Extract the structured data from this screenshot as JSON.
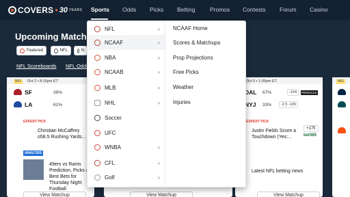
{
  "brand": {
    "name": "COVERS",
    "badge": "30",
    "years": "YEARS",
    "accent": "#f26b3a"
  },
  "nav": [
    "Sports",
    "Odds",
    "Picks",
    "Betting",
    "Promos",
    "Contests",
    "Forum",
    "Casino"
  ],
  "page": {
    "title": "Upcoming Matchups",
    "chips": [
      "Featured",
      "NFL",
      "N"
    ],
    "links": [
      "NFL Scoreboards",
      "NFL Odds"
    ]
  },
  "cards": {
    "left": {
      "tag": "NFL",
      "date": "Oct 2 • 8:15pm ET",
      "teams": [
        {
          "abbr": "SF",
          "pct": "39%"
        },
        {
          "abbr": "LA",
          "pct": "61%"
        }
      ],
      "expert_label": "EXPERT PICK",
      "expert_text": "Christian McCaffrey o58.5 Rushing Yards...",
      "analysis_label": "ANALYSIS",
      "analysis_text": "49ers vs Rams Prediction, Picks & Best Bets for Thursday Night Football",
      "button": "View Matchup"
    },
    "right": {
      "tag": "NFL",
      "date": "Oct 5 • 1:00pm ET",
      "teams": [
        {
          "abbr": "DAL",
          "pct": "67%",
          "odds": "-104"
        },
        {
          "abbr": "NYJ",
          "pct": "33%",
          "odds": "-2.5 -105"
        }
      ],
      "expert_label": "EXPERT PICK",
      "expert_text": "Justin Fields Score a Touchdown (Yes:...",
      "expert_odds": "+175",
      "book": "bet365",
      "analysis_text": "Latest NFL betting news",
      "button": "View Matchup"
    },
    "far_right": {
      "tag": "NFL"
    },
    "mid_button": "View Matchup"
  },
  "dropdown": {
    "sports": [
      {
        "label": "NFL",
        "has_sub": true,
        "icon": "football-icon"
      },
      {
        "label": "NCAAF",
        "has_sub": true,
        "icon": "football-icon"
      },
      {
        "label": "NBA",
        "has_sub": true,
        "icon": "basketball-icon"
      },
      {
        "label": "NCAAB",
        "has_sub": true,
        "icon": "basketball-icon"
      },
      {
        "label": "MLB",
        "has_sub": true,
        "icon": "baseball-icon"
      },
      {
        "label": "NHL",
        "has_sub": true,
        "icon": "hockey-icon"
      },
      {
        "label": "Soccer",
        "has_sub": false,
        "icon": "soccer-icon"
      },
      {
        "label": "UFC",
        "has_sub": false,
        "icon": "ufc-icon"
      },
      {
        "label": "WNBA",
        "has_sub": true,
        "icon": "basketball-icon"
      },
      {
        "label": "CFL",
        "has_sub": true,
        "icon": "football-icon"
      },
      {
        "label": "Golf",
        "has_sub": true,
        "icon": "golf-icon"
      }
    ],
    "active": "NCAAF",
    "submenu": [
      "NCAAF Home",
      "Scores & Matchups",
      "Prop Projections",
      "Free Picks",
      "Weather",
      "Injuries"
    ]
  }
}
